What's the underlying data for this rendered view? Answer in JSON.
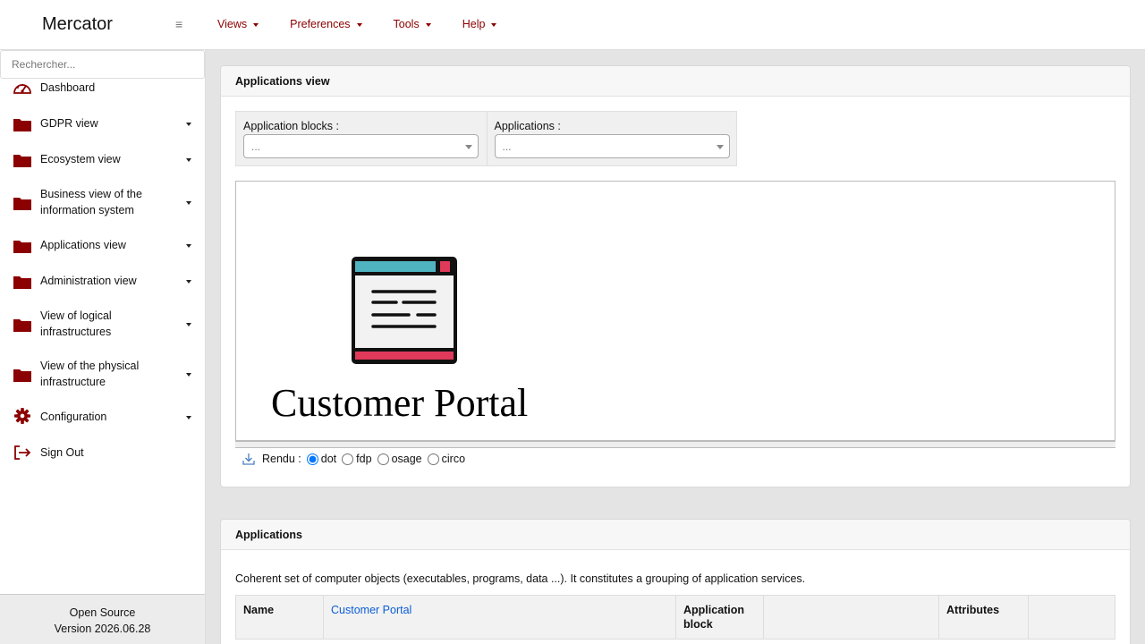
{
  "app": {
    "title": "Mercator",
    "menu_icon": "hamburger-icon"
  },
  "topnav": [
    {
      "label": "Views"
    },
    {
      "label": "Preferences"
    },
    {
      "label": "Tools"
    },
    {
      "label": "Help"
    }
  ],
  "sidebar": {
    "search_placeholder": "Rechercher...",
    "items": [
      {
        "label": "Dashboard",
        "icon": "dashboard-icon"
      },
      {
        "label": "GDPR view",
        "icon": "folder-icon"
      },
      {
        "label": "Ecosystem view",
        "icon": "folder-icon"
      },
      {
        "label": "Business view of the information system",
        "icon": "folder-icon"
      },
      {
        "label": "Applications view",
        "icon": "folder-icon"
      },
      {
        "label": "Administration view",
        "icon": "folder-icon"
      },
      {
        "label": "View of logical infrastructures",
        "icon": "folder-icon"
      },
      {
        "label": "View of the physical infrastructure",
        "icon": "folder-icon"
      },
      {
        "label": "Configuration",
        "icon": "gear-icon"
      },
      {
        "label": "Sign Out",
        "icon": "sign-out-icon"
      }
    ],
    "footer": {
      "line1": "Open Source",
      "line2": "Version 2026.06.28"
    }
  },
  "applications_view": {
    "title": "Applications view",
    "filters": {
      "blocks_label": "Application blocks :",
      "blocks_value": "...",
      "apps_label": "Applications :",
      "apps_value": "..."
    },
    "graph": {
      "node_label": "Customer Portal",
      "node_icon": "application-window-icon"
    },
    "render": {
      "label": "Rendu :",
      "options": [
        "dot",
        "fdp",
        "osage",
        "circo"
      ],
      "selected": "dot"
    }
  },
  "applications": {
    "title": "Applications",
    "description": "Coherent set of computer objects (executables, programs, data ...). It constitutes a grouping of application services.",
    "table": {
      "name_header": "Name",
      "name_value": "Customer Portal",
      "block_header": "Application block",
      "block_value": "",
      "attributes_header": "Attributes",
      "attributes_value": ""
    }
  },
  "colors": {
    "accent": "#8b0000",
    "link": "#0b5ed7"
  }
}
